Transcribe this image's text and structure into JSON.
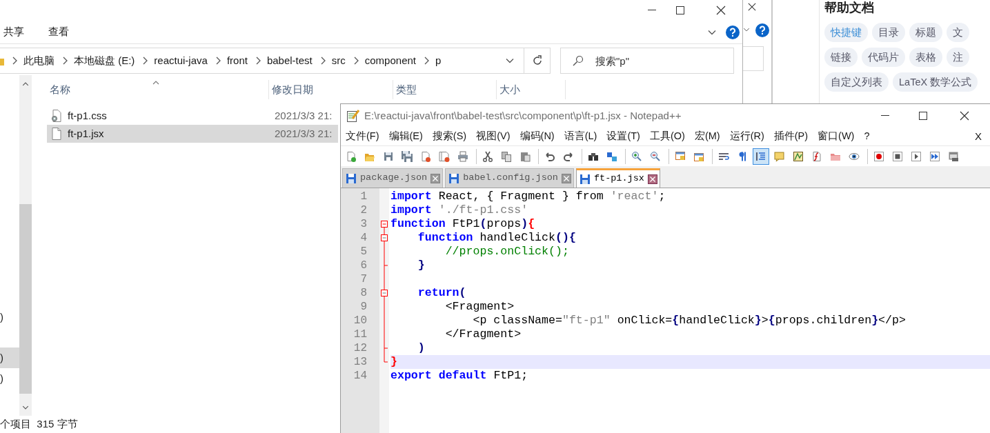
{
  "help_panel": {
    "title": "帮助文档",
    "tag_rows": [
      [
        {
          "label": "快捷键",
          "selected": true
        },
        {
          "label": "目录",
          "selected": false
        },
        {
          "label": "标题",
          "selected": false
        },
        {
          "label": "文",
          "selected": false
        }
      ],
      [
        {
          "label": "链接",
          "selected": false
        },
        {
          "label": "代码片",
          "selected": false
        },
        {
          "label": "表格",
          "selected": false
        },
        {
          "label": "注",
          "selected": false
        }
      ],
      [
        {
          "label": "自定义列表",
          "selected": false
        },
        {
          "label": "LaTeX 数学公式",
          "selected": false
        }
      ]
    ]
  },
  "explorer": {
    "ribbon_tabs": [
      "共享",
      "查看"
    ],
    "breadcrumb": [
      "此电脑",
      "本地磁盘 (E:)",
      "reactui-java",
      "front",
      "babel-test",
      "src",
      "component",
      "p"
    ],
    "search": {
      "placeholder": "搜索\"p\""
    },
    "nav_items": [
      {
        "label": ")",
        "selected": false
      },
      {
        "label": ")",
        "selected": true
      },
      {
        "label": ")",
        "selected": false
      }
    ],
    "columns": [
      "名称",
      "修改日期",
      "类型",
      "大小"
    ],
    "files": [
      {
        "name": "ft-p1.css",
        "kind": "css",
        "modified": "2021/3/3 21:",
        "selected": false
      },
      {
        "name": "ft-p1.jsx",
        "kind": "jsx",
        "modified": "2021/3/3 21:",
        "selected": true
      }
    ],
    "status": "个项目  315 字节"
  },
  "notepad": {
    "title": "E:\\reactui-java\\front\\babel-test\\src\\component\\p\\ft-p1.jsx - Notepad++",
    "menu": [
      "文件(F)",
      "编辑(E)",
      "搜索(S)",
      "视图(V)",
      "编码(N)",
      "语言(L)",
      "设置(T)",
      "工具(O)",
      "宏(M)",
      "运行(R)",
      "插件(P)",
      "窗口(W)",
      "?"
    ],
    "close_document": "X",
    "toolbar": [
      [
        {
          "pressed": false
        },
        {
          "pressed": false
        },
        {
          "pressed": false
        },
        {
          "pressed": false
        },
        {
          "pressed": false
        },
        {
          "pressed": false
        },
        {
          "pressed": false
        }
      ],
      [
        {
          "pressed": false
        },
        {
          "pressed": false
        },
        {
          "pressed": false
        }
      ],
      [
        {
          "pressed": false
        },
        {
          "pressed": false
        }
      ],
      [
        {
          "pressed": false
        },
        {
          "pressed": false
        }
      ],
      [
        {
          "pressed": false
        },
        {
          "pressed": false
        }
      ],
      [
        {
          "pressed": false
        },
        {
          "pressed": false
        }
      ],
      [
        {
          "pressed": false
        },
        {
          "pressed": false
        },
        {
          "pressed": true
        },
        {
          "pressed": false
        },
        {
          "pressed": false
        },
        {
          "pressed": false
        },
        {
          "pressed": false
        },
        {
          "pressed": false
        }
      ],
      [
        {
          "pressed": false
        },
        {
          "pressed": false
        },
        {
          "pressed": false
        },
        {
          "pressed": false
        },
        {
          "pressed": false
        }
      ]
    ],
    "tabs": [
      {
        "label": "package.json",
        "selected": false
      },
      {
        "label": "babel.config.json",
        "selected": false
      },
      {
        "label": "ft-p1.jsx",
        "selected": true
      }
    ],
    "lines": [
      {
        "number": "1",
        "current": false,
        "tokens": [
          {
            "kind": "keyword",
            "text": "import"
          },
          {
            "kind": "text",
            "text": " React, { Fragment } from "
          },
          {
            "kind": "string",
            "text": "'react'"
          },
          {
            "kind": "text",
            "text": ";"
          }
        ]
      },
      {
        "number": "2",
        "current": false,
        "tokens": [
          {
            "kind": "keyword",
            "text": "import "
          },
          {
            "kind": "string",
            "text": "'./ft-p1.css'"
          }
        ]
      },
      {
        "number": "3",
        "fold": {
          "kind": "head"
        },
        "current": false,
        "tokens": [
          {
            "kind": "keyword",
            "text": "function"
          },
          {
            "kind": "text",
            "text": " FtP1"
          },
          {
            "kind": "operator",
            "text": "("
          },
          {
            "kind": "text",
            "text": "props"
          },
          {
            "kind": "operator",
            "text": ")"
          },
          {
            "kind": "match",
            "text": "{"
          }
        ]
      },
      {
        "number": "4",
        "fold": {
          "kind": "branch"
        },
        "current": false,
        "tokens": [
          {
            "kind": "keyword",
            "text": "    function"
          },
          {
            "kind": "text",
            "text": " handleClick"
          },
          {
            "kind": "operator",
            "text": "(){"
          }
        ]
      },
      {
        "number": "5",
        "fold": {
          "kind": "line"
        },
        "current": false,
        "tokens": [
          {
            "kind": "comment",
            "text": "        //props.onClick();"
          }
        ]
      },
      {
        "number": "6",
        "fold": {
          "kind": "tick"
        },
        "current": false,
        "tokens": [
          {
            "kind": "operator",
            "text": "    }"
          }
        ]
      },
      {
        "number": "7",
        "fold": {
          "kind": "line"
        },
        "current": false
      },
      {
        "number": "8",
        "fold": {
          "kind": "branch"
        },
        "current": false,
        "tokens": [
          {
            "kind": "keyword",
            "text": "    return"
          },
          {
            "kind": "operator",
            "text": "("
          }
        ]
      },
      {
        "number": "9",
        "fold": {
          "kind": "line"
        },
        "current": false,
        "tokens": [
          {
            "kind": "text",
            "text": "        <Fragment>"
          }
        ]
      },
      {
        "number": "10",
        "fold": {
          "kind": "line"
        },
        "current": false,
        "tokens": [
          {
            "kind": "text",
            "text": "            <p className="
          },
          {
            "kind": "string",
            "text": "\"ft-p1\""
          },
          {
            "kind": "text",
            "text": " onClick="
          },
          {
            "kind": "operator",
            "text": "{"
          },
          {
            "kind": "text",
            "text": "handleClick"
          },
          {
            "kind": "operator",
            "text": "}"
          },
          {
            "kind": "text",
            "text": ">"
          },
          {
            "kind": "operator",
            "text": "{"
          },
          {
            "kind": "text",
            "text": "props.children"
          },
          {
            "kind": "operator",
            "text": "}"
          },
          {
            "kind": "text",
            "text": "</p>"
          }
        ]
      },
      {
        "number": "11",
        "fold": {
          "kind": "line"
        },
        "current": false,
        "tokens": [
          {
            "kind": "text",
            "text": "        </Fragment>"
          }
        ]
      },
      {
        "number": "12",
        "fold": {
          "kind": "tick"
        },
        "current": false,
        "tokens": [
          {
            "kind": "operator",
            "text": "    )"
          }
        ]
      },
      {
        "number": "13",
        "fold": {
          "kind": "tail"
        },
        "current": true,
        "tokens": [
          {
            "kind": "match",
            "text": "}"
          }
        ]
      },
      {
        "number": "14",
        "current": false,
        "tokens": [
          {
            "kind": "keyword",
            "text": "export default"
          },
          {
            "kind": "text",
            "text": " FtP1;"
          }
        ]
      }
    ]
  }
}
